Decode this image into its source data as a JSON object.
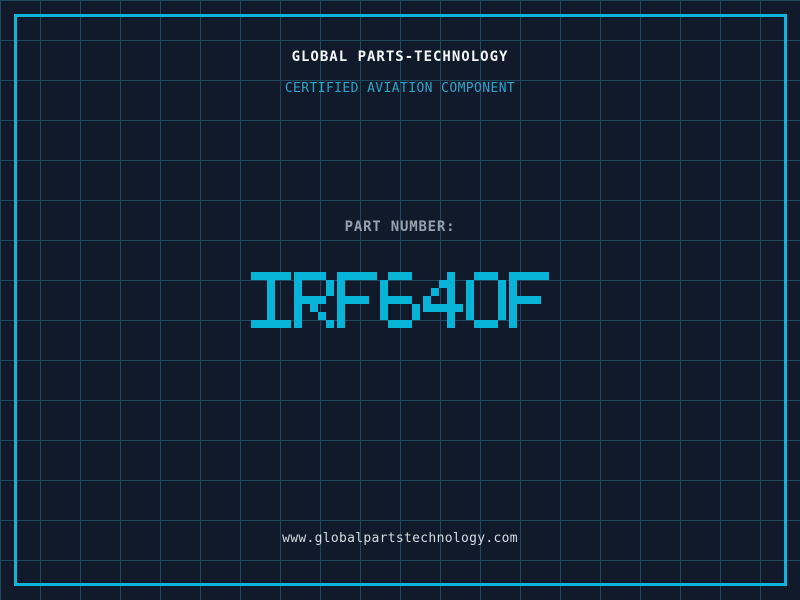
{
  "header": {
    "title": "GLOBAL PARTS-TECHNOLOGY",
    "subtitle": "CERTIFIED AVIATION COMPONENT"
  },
  "part": {
    "label": "PART NUMBER:",
    "value": "IRF640F"
  },
  "footer": {
    "website": "www.globalpartstechnology.com"
  },
  "colors": {
    "background": "#101a2b",
    "grid_line": "#1d4a5e",
    "frame_cyan": "#0db5dc",
    "part_number_cyan": "#07b4d8",
    "subtitle_cyan": "#2ea4c9",
    "label_gray": "#97a1ad",
    "title_white": "#f4f6f8",
    "website_white": "#d5dbe0"
  }
}
